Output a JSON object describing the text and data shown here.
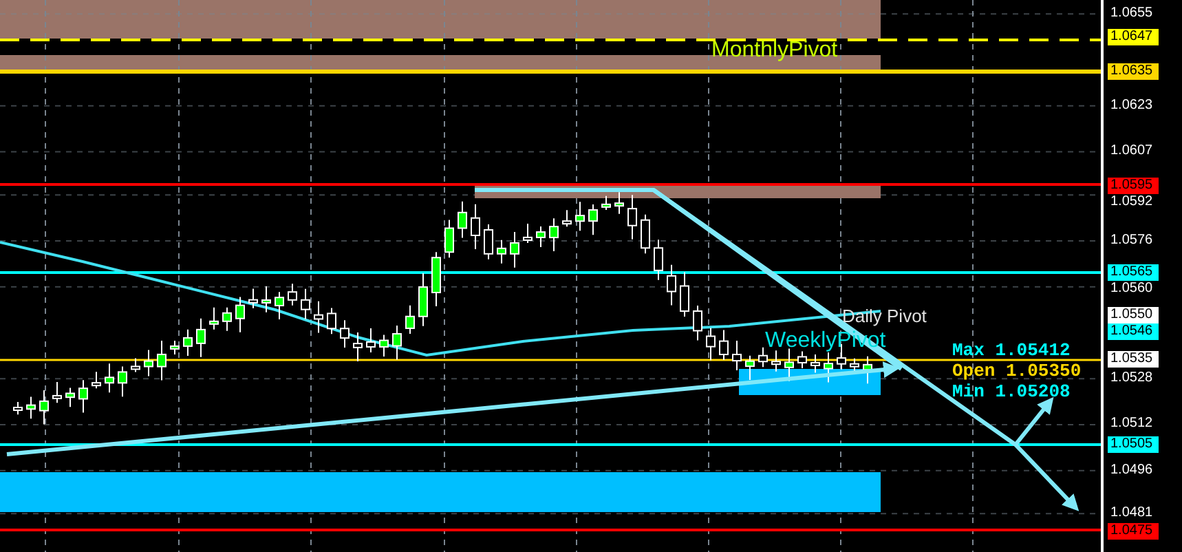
{
  "price_axis": [
    {
      "text": "1.0655",
      "kind": "tick"
    },
    {
      "text": "1.0647",
      "kind": "tag",
      "color": "#ffff00"
    },
    {
      "text": "1.0635",
      "kind": "tag",
      "color": "#ffd700"
    },
    {
      "text": "1.0623",
      "kind": "tick"
    },
    {
      "text": "1.0607",
      "kind": "tick"
    },
    {
      "text": "1.0595",
      "kind": "tag",
      "color": "#ff0000"
    },
    {
      "text": "1.0592",
      "kind": "tick"
    },
    {
      "text": "1.0576",
      "kind": "tick"
    },
    {
      "text": "1.0565",
      "kind": "tag",
      "color": "#00ffff"
    },
    {
      "text": "1.0560",
      "kind": "tick"
    },
    {
      "text": "1.0550",
      "kind": "tag",
      "color": "#ffffff"
    },
    {
      "text": "1.0546",
      "kind": "tag",
      "color": "#00ffff"
    },
    {
      "text": "1.0535",
      "kind": "tag",
      "color": "#ffffff"
    },
    {
      "text": "1.0528",
      "kind": "tick"
    },
    {
      "text": "1.0512",
      "kind": "tick"
    },
    {
      "text": "1.0505",
      "kind": "tag",
      "color": "#00ffff"
    },
    {
      "text": "1.0496",
      "kind": "tick"
    },
    {
      "text": "1.0481",
      "kind": "tick"
    },
    {
      "text": "1.0475",
      "kind": "tag",
      "color": "#ff0000"
    }
  ],
  "pivot_labels": [
    {
      "text": "MonthlyPivot",
      "kind": "monthly"
    },
    {
      "text": "Daily Pivot",
      "kind": "daily"
    },
    {
      "text": "WeeklyPivot",
      "kind": "weekly"
    }
  ],
  "stats": [
    {
      "label": "Max",
      "value": "1.05412",
      "color": "#00ffff"
    },
    {
      "label": "Open",
      "value": "1.05350",
      "color": "#ffd700"
    },
    {
      "label": "Min",
      "value": "1.05208",
      "color": "#00ffff"
    }
  ]
}
